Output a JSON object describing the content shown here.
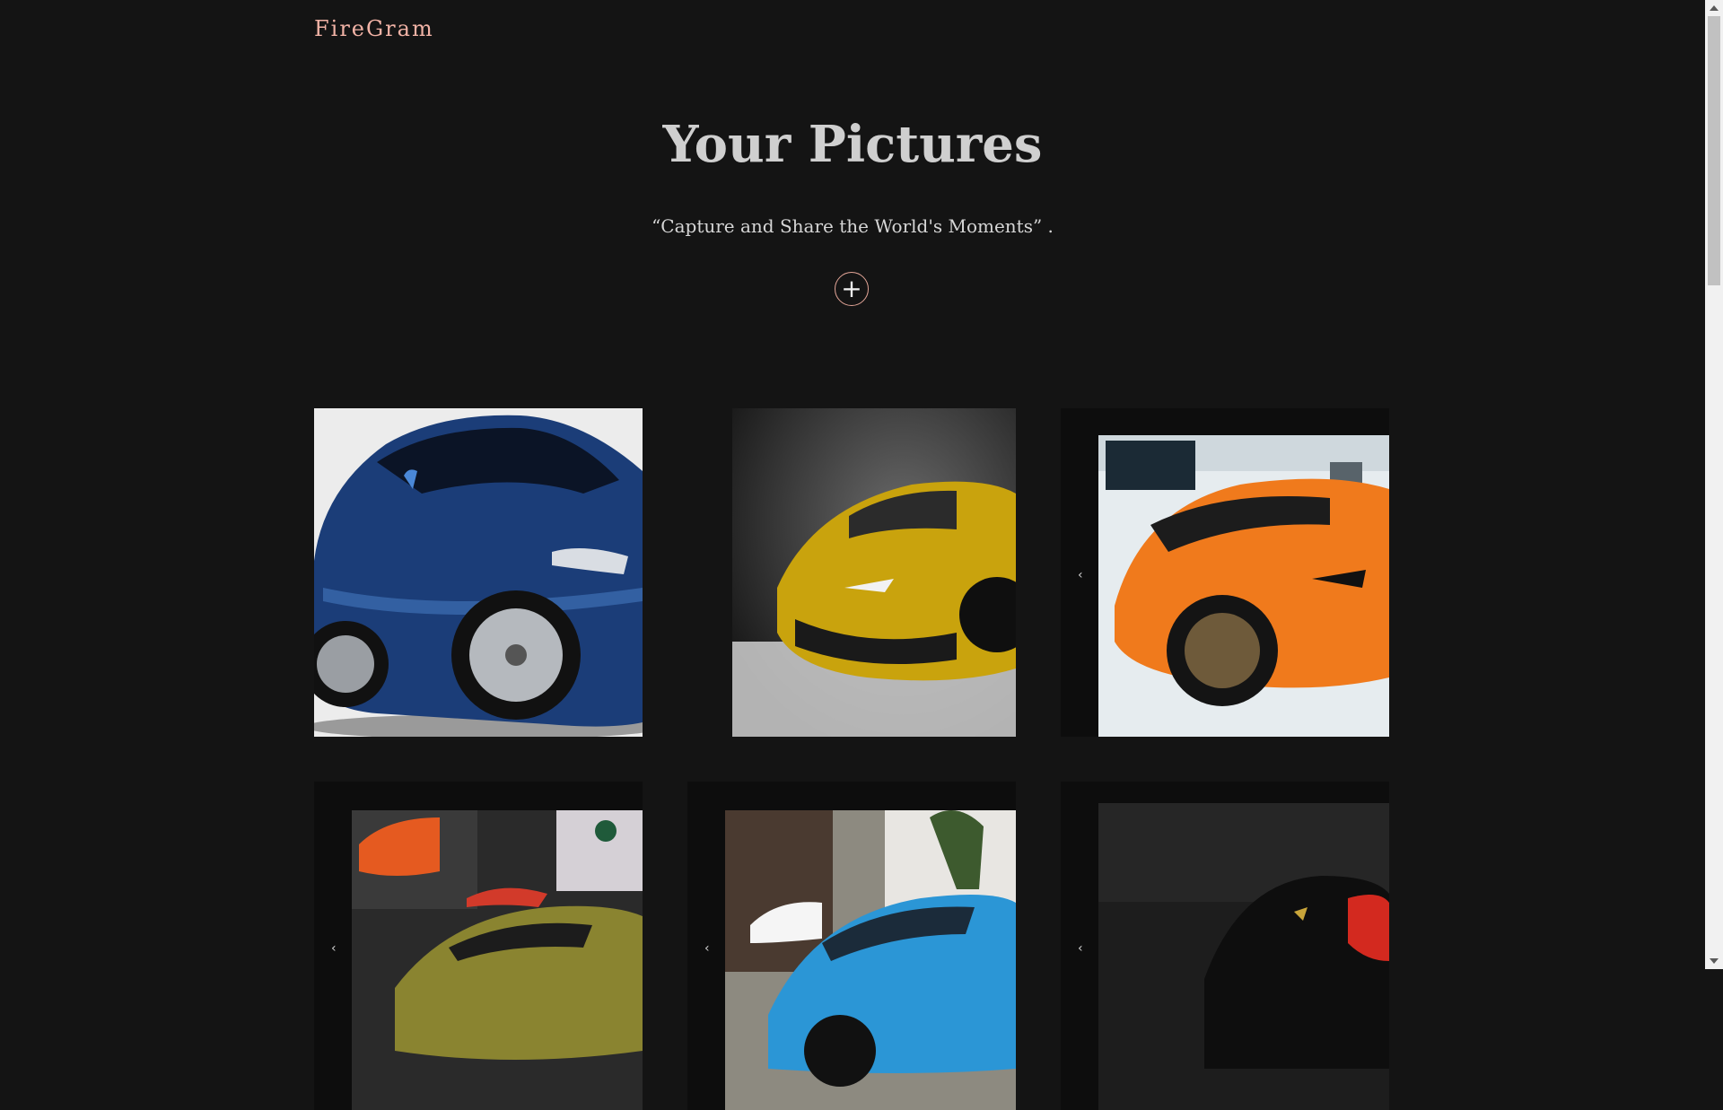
{
  "brand": "FireGram",
  "hero": {
    "title": "Your Pictures",
    "subtitle": "“Capture and Share the World's Moments” ."
  },
  "add_button": {
    "symbol": "+"
  },
  "gallery": [
    {
      "subject": "blue sedan"
    },
    {
      "subject": "yellow supercar"
    },
    {
      "subject": "orange supercar"
    },
    {
      "subject": "olive supercar at auto show"
    },
    {
      "subject": "light blue supercar on street"
    },
    {
      "subject": "covered car in dark garage"
    }
  ],
  "colors": {
    "background": "#141414",
    "brand": "#f2b3a6",
    "accent": "#e3a597"
  }
}
